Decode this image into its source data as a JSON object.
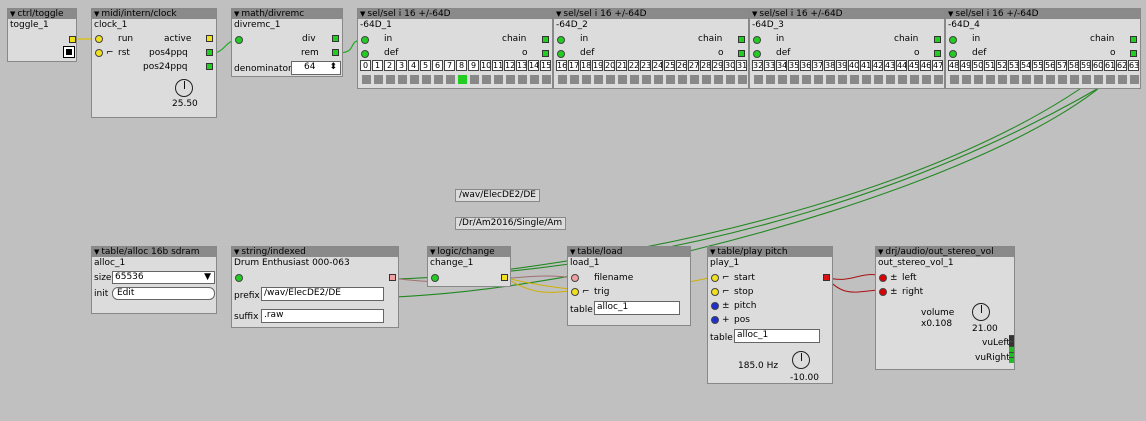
{
  "comments": [
    "/wav/ElecDE2/DE",
    "/Dr/Am2016/Single/Am"
  ],
  "toggle": {
    "type": "ctrl/toggle",
    "name": "toggle_1"
  },
  "clock": {
    "type": "midi/intern/clock",
    "name": "clock_1",
    "in_run": "run",
    "in_rst": "rst",
    "out_active": "active",
    "out_pos4": "pos4ppq",
    "out_pos24": "pos24ppq",
    "knob_value": "25.50"
  },
  "divremc": {
    "type": "math/divremc",
    "name": "divremc_1",
    "out_div": "div",
    "out_rem": "rem",
    "denominator_label": "denominator",
    "denominator_value": "64"
  },
  "sel": [
    {
      "type": "sel/sel i 16 +/-64D",
      "name": "-64D_1",
      "in": "in",
      "def": "def",
      "chain": "chain",
      "o": "o"
    },
    {
      "type": "sel/sel i 16 +/-64D",
      "name": "-64D_2",
      "in": "in",
      "def": "def",
      "chain": "chain",
      "o": "o"
    },
    {
      "type": "sel/sel i 16 +/-64D",
      "name": "-64D_3",
      "in": "in",
      "def": "def",
      "chain": "chain",
      "o": "o"
    },
    {
      "type": "sel/sel i 16 +/-64D",
      "name": "-64D_4",
      "in": "in",
      "def": "def",
      "chain": "chain",
      "o": "o"
    }
  ],
  "sel_cells": [
    "0",
    "1",
    "2",
    "3",
    "4",
    "5",
    "6",
    "7",
    "8",
    "9",
    "10",
    "11",
    "12",
    "13",
    "14",
    "15",
    "16",
    "17",
    "18",
    "19",
    "20",
    "21",
    "22",
    "23",
    "24",
    "25",
    "26",
    "27",
    "28",
    "29",
    "30",
    "31",
    "32",
    "33",
    "34",
    "35",
    "36",
    "37",
    "38",
    "39",
    "40",
    "41",
    "42",
    "43",
    "44",
    "45",
    "46",
    "47",
    "48",
    "49",
    "50",
    "51",
    "52",
    "53",
    "54",
    "55",
    "56",
    "57",
    "58",
    "59",
    "60",
    "61",
    "62",
    "63"
  ],
  "sel_active_index": 8,
  "alloc": {
    "type": "table/alloc 16b sdram",
    "name": "alloc_1",
    "size_label": "size",
    "size_value": "65536",
    "init_label": "init",
    "init_button": "Edit"
  },
  "indexed": {
    "type": "string/indexed",
    "name": "Drum Enthusiast 000-063",
    "prefix_label": "prefix",
    "prefix_value": "/wav/ElecDE2/DE",
    "suffix_label": "suffix",
    "suffix_value": ".raw"
  },
  "change": {
    "type": "logic/change",
    "name": "change_1"
  },
  "load": {
    "type": "table/load",
    "name": "load_1",
    "in_filename": "filename",
    "in_trig": "trig",
    "table_label": "table",
    "table_value": "alloc_1"
  },
  "play": {
    "type": "table/play pitch",
    "name": "play_1",
    "in_start": "start",
    "in_stop": "stop",
    "in_pitch": "pitch",
    "in_pos": "pos",
    "table_label": "table",
    "table_value": "alloc_1",
    "freq": "185.0 Hz",
    "knob_value": "-10.00"
  },
  "out": {
    "type": "drj/audio/out_stereo_vol",
    "name": "out_stereo_vol_1",
    "in_left": "left",
    "in_right": "right",
    "volume_label": "volume",
    "volume_value": "x0.108",
    "knob_value": "21.00",
    "vu_left": "vuLeft",
    "vu_right": "vuRight"
  },
  "glyphs": {
    "triangle": "▼",
    "pm": "±",
    "arrows": "⬍",
    "select_arrow": "▼"
  }
}
